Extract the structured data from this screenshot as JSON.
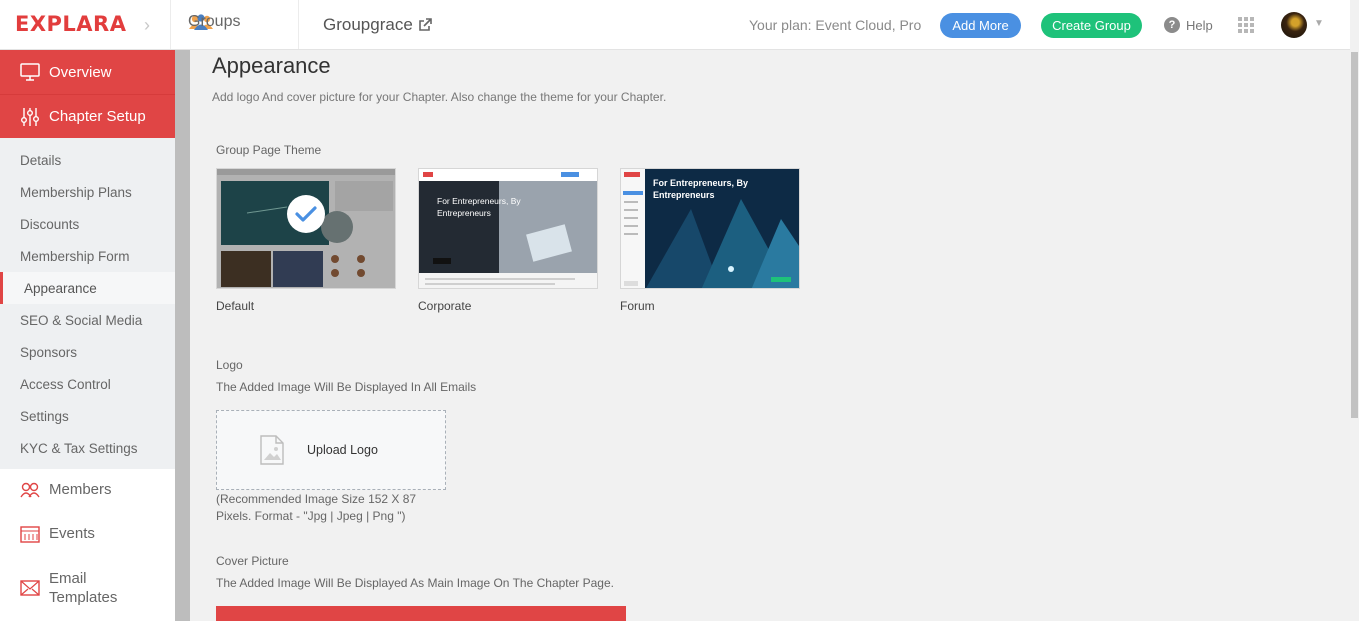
{
  "header": {
    "logo_text": "EXPLARA",
    "groups_label": "Groups",
    "group_name": "Groupgrace",
    "plan_text": "Your plan: Event Cloud, Pro",
    "add_more_label": "Add More",
    "create_group_label": "Create Group",
    "help_label": "Help",
    "colors": {
      "brand": "#e23d3d",
      "add_more": "#4a90e2",
      "create_group": "#1ec27a"
    }
  },
  "sidebar": {
    "main_items": [
      {
        "label": "Overview",
        "icon": "monitor-icon"
      },
      {
        "label": "Chapter Setup",
        "icon": "sliders-icon"
      }
    ],
    "sub_items": [
      {
        "label": "Details"
      },
      {
        "label": "Membership Plans"
      },
      {
        "label": "Discounts"
      },
      {
        "label": "Membership Form"
      },
      {
        "label": "Appearance",
        "active": true
      },
      {
        "label": "SEO & Social Media"
      },
      {
        "label": "Sponsors"
      },
      {
        "label": "Access Control"
      },
      {
        "label": "Settings"
      },
      {
        "label": "KYC & Tax Settings"
      }
    ],
    "bottom_items": [
      {
        "label": "Members",
        "icon": "members-icon"
      },
      {
        "label": "Events",
        "icon": "calendar-icon"
      },
      {
        "label": "Email Templates",
        "icon": "envelope-icon"
      }
    ]
  },
  "main": {
    "title": "Appearance",
    "subtitle": "Add logo And cover picture for your Chapter. Also change the theme for your Chapter.",
    "theme_section_label": "Group Page Theme",
    "themes": [
      {
        "name": "Default",
        "selected": true
      },
      {
        "name": "Corporate",
        "selected": false,
        "preview_text": "For Entrepreneurs, By Entrepreneurs"
      },
      {
        "name": "Forum",
        "selected": false,
        "preview_text": "For Entrepreneurs, By Entrepreneurs"
      }
    ],
    "logo": {
      "label": "Logo",
      "hint": "The Added Image Will Be Displayed In All Emails",
      "upload_label": "Upload Logo",
      "recommendation_line1": "(Recommended Image Size 152 X 87",
      "recommendation_line2": "Pixels. Format - \"Jpg | Jpeg | Png \")"
    },
    "cover": {
      "label": "Cover Picture",
      "hint": "The Added Image Will Be Displayed As Main Image On The Chapter Page."
    }
  }
}
